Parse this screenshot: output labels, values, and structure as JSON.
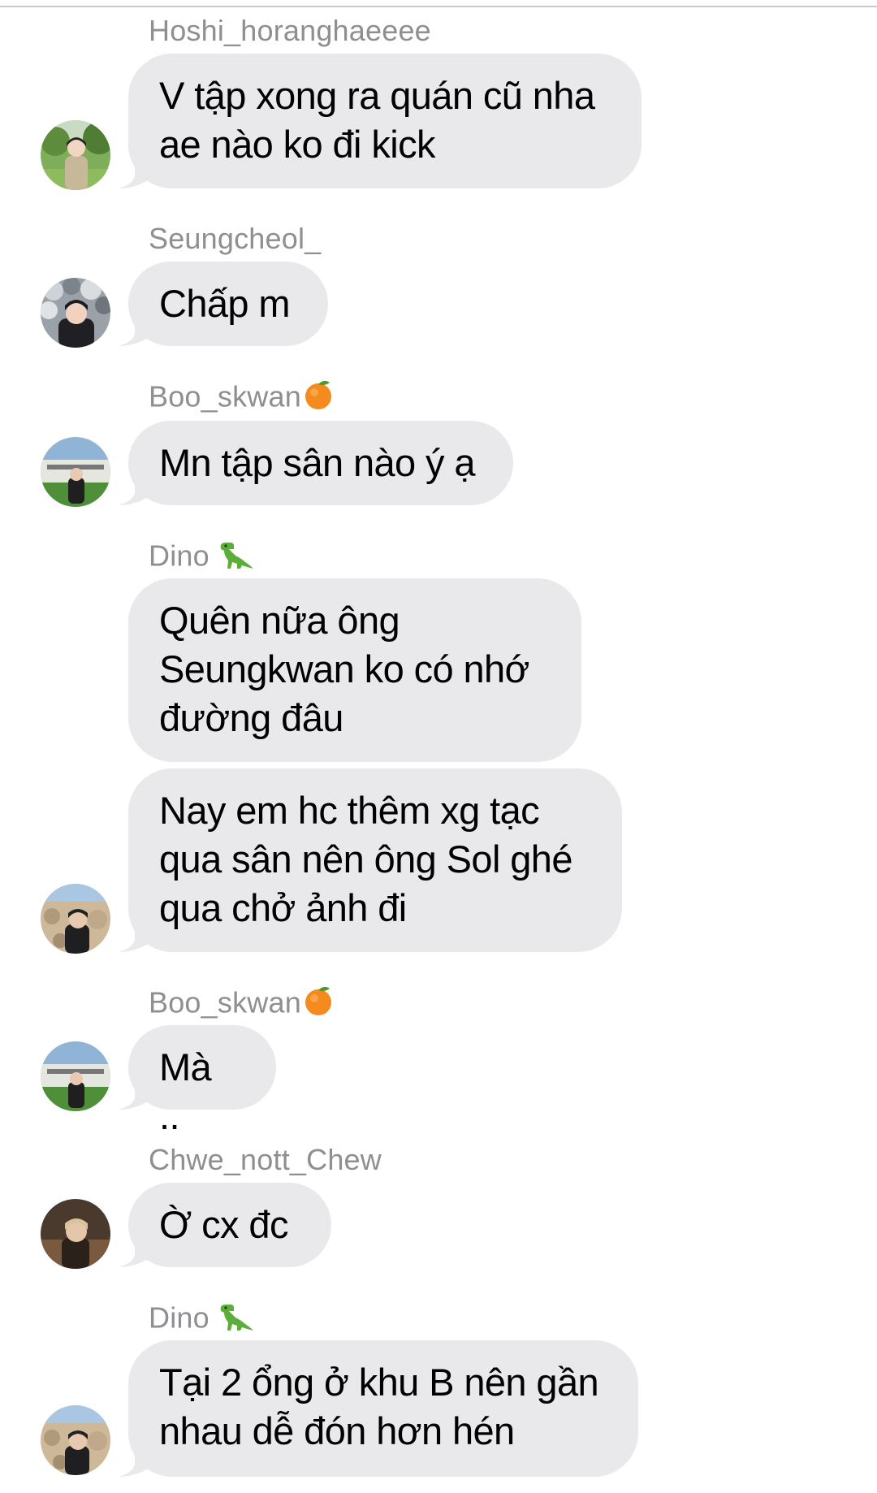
{
  "colors": {
    "bubble": "#e9e9eb",
    "sender_text": "#8e8e93",
    "message_text": "#000000",
    "background": "#ffffff"
  },
  "messages": [
    {
      "sender": "Hoshi_horanghaeeee",
      "text": "V tập xong ra quán cũ nha\nae nào ko đi kick",
      "avatar": "avatar-park"
    },
    {
      "sender": "Seungcheol_",
      "text": "Chấp m",
      "avatar": "avatar-balloons"
    },
    {
      "sender": "Boo_skwan",
      "sender_emoji": "orange-emoji",
      "text": "Mn tập sân nào ý ạ",
      "avatar": "avatar-sign"
    },
    {
      "sender": "Dino",
      "sender_emoji": "dinosaur-emoji",
      "text": "Quên nữa ông\nSeungkwan ko có nhớ\nđường đâu"
    },
    {
      "text": "Nay em hc thêm xg tạc\nqua sân nên ông Sol ghé\nqua chở ảnh đi",
      "avatar": "avatar-rocks"
    },
    {
      "sender": "Boo_skwan",
      "sender_emoji": "orange-emoji",
      "text": "Mà ..",
      "avatar": "avatar-sign"
    },
    {
      "sender": "Chwe_nott_Chew",
      "text": "Ờ cx đc",
      "avatar": "avatar-dark"
    },
    {
      "sender": "Dino",
      "sender_emoji": "dinosaur-emoji",
      "text": "Tại 2 ổng ở khu B nên gần\nnhau dễ đón hơn hén",
      "avatar": "avatar-rocks"
    }
  ]
}
